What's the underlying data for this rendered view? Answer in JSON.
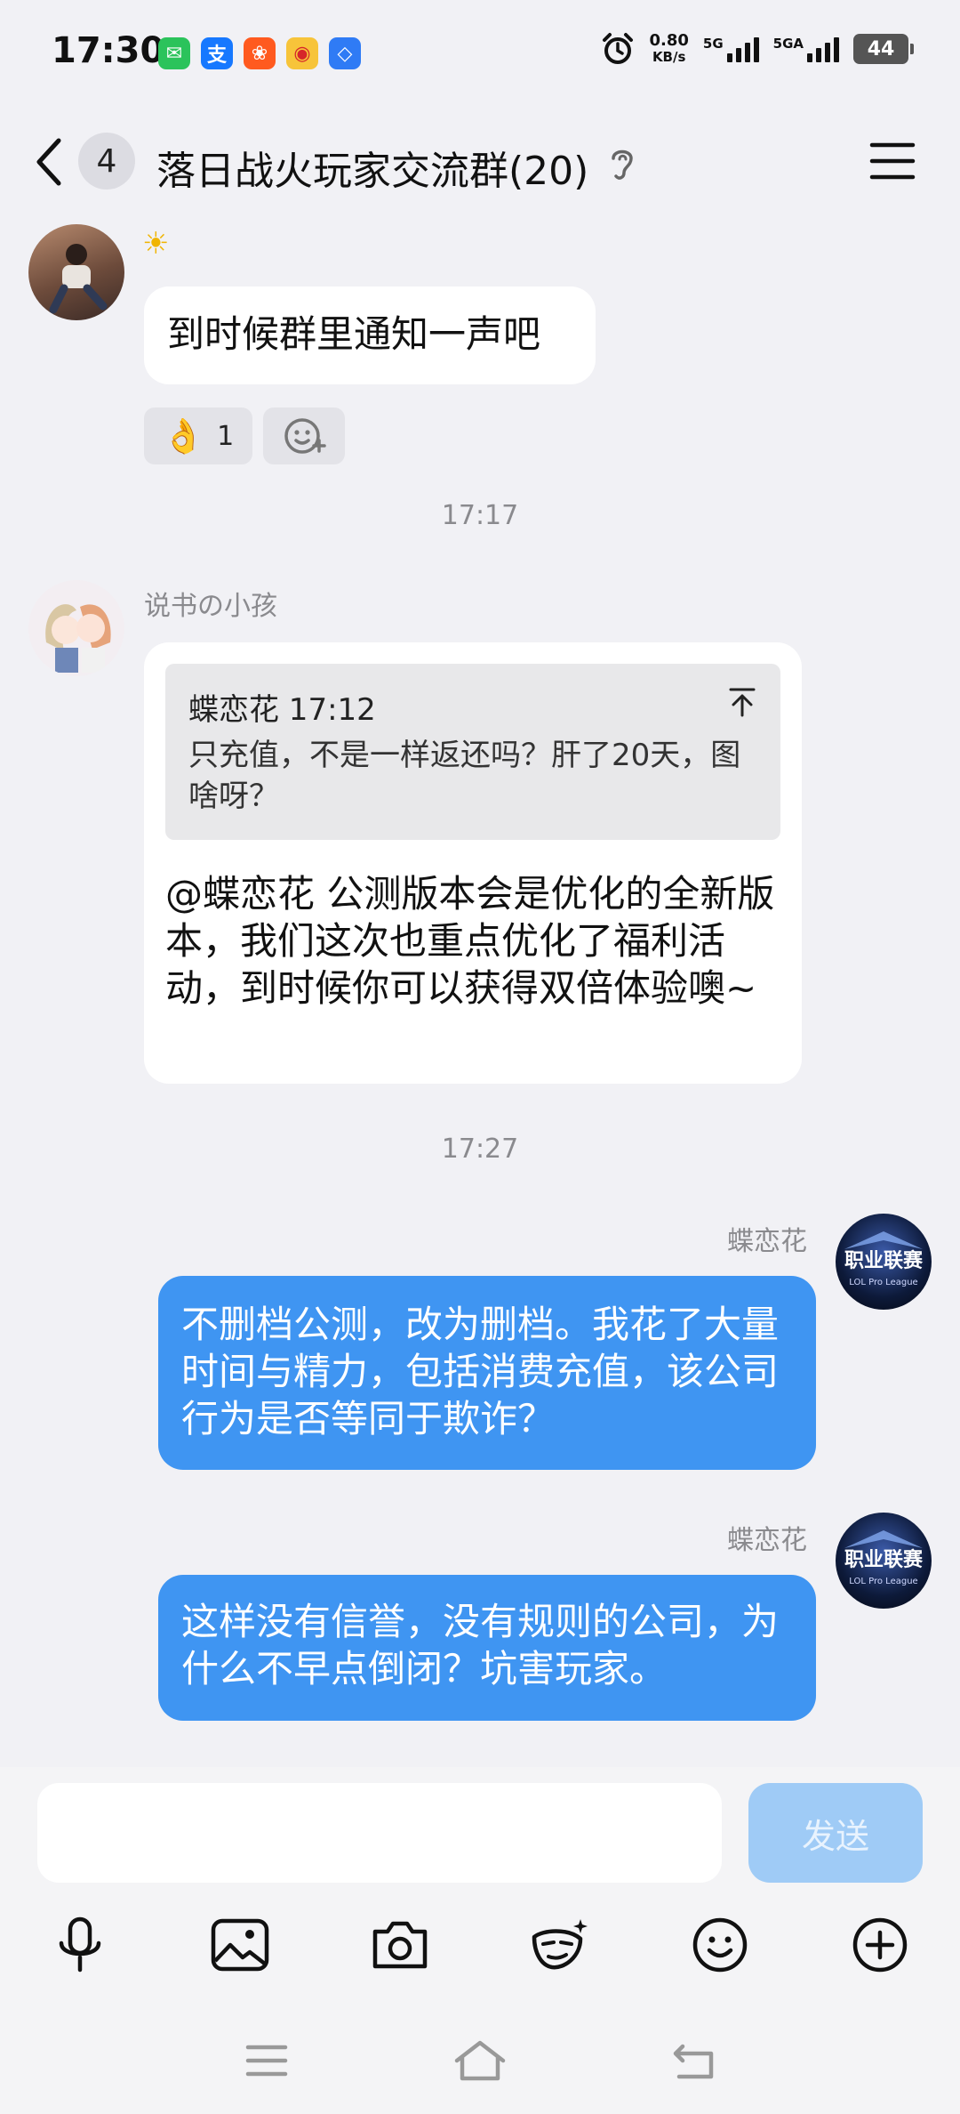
{
  "status_bar": {
    "time": "17:30",
    "net_speed_value": "0.80",
    "net_speed_unit": "KB/s",
    "network1": "5G",
    "network2": "5GA",
    "battery": "44",
    "apps": [
      {
        "icon": "wechat-icon",
        "glyph": "✉",
        "color": "#2bc35b"
      },
      {
        "icon": "alipay-icon",
        "glyph": "支",
        "color": "#1678ff"
      },
      {
        "icon": "app-icon",
        "glyph": "❀",
        "color": "#ff5a1f"
      },
      {
        "icon": "weibo-icon",
        "glyph": "◉",
        "color": "#f7c43a"
      },
      {
        "icon": "app-diamond-icon",
        "glyph": "◇",
        "color": "#2f7bf5"
      }
    ]
  },
  "header": {
    "unread_count": "4",
    "title": "落日战火玩家交流群(20)"
  },
  "messages": {
    "m1": {
      "sender_badge": "☀",
      "text": "到时候群里通知一声吧",
      "reaction_emoji": "👌",
      "reaction_count": "1"
    },
    "t1": "17:17",
    "m2": {
      "sender": "说书の小孩",
      "quote_author_time": "蝶恋花 17:12",
      "quote_text": "只充值，不是一样返还吗？肝了20天，图啥呀？",
      "text": "@蝶恋花 公测版本会是优化的全新版本，我们这次也重点优化了福利活动，到时候你可以获得双倍体验噢~"
    },
    "t2": "17:27",
    "m3": {
      "sender": "蝶恋花",
      "avatar_text": "职业联赛",
      "avatar_sub": "LOL Pro League",
      "text": "不删档公测，改为删档。我花了大量时间与精力，包括消费充值，该公司行为是否等同于欺诈？"
    },
    "m4": {
      "sender": "蝶恋花",
      "avatar_text": "职业联赛",
      "avatar_sub": "LOL Pro League",
      "text": "这样没有信誉，没有规则的公司，为什么不早点倒闭？坑害玩家。"
    }
  },
  "input": {
    "placeholder": "",
    "send_label": "发送"
  },
  "colors": {
    "outgoing_bubble": "#3f95f2",
    "send_disabled": "#9fcbf6",
    "background": "#f1f1f5"
  }
}
